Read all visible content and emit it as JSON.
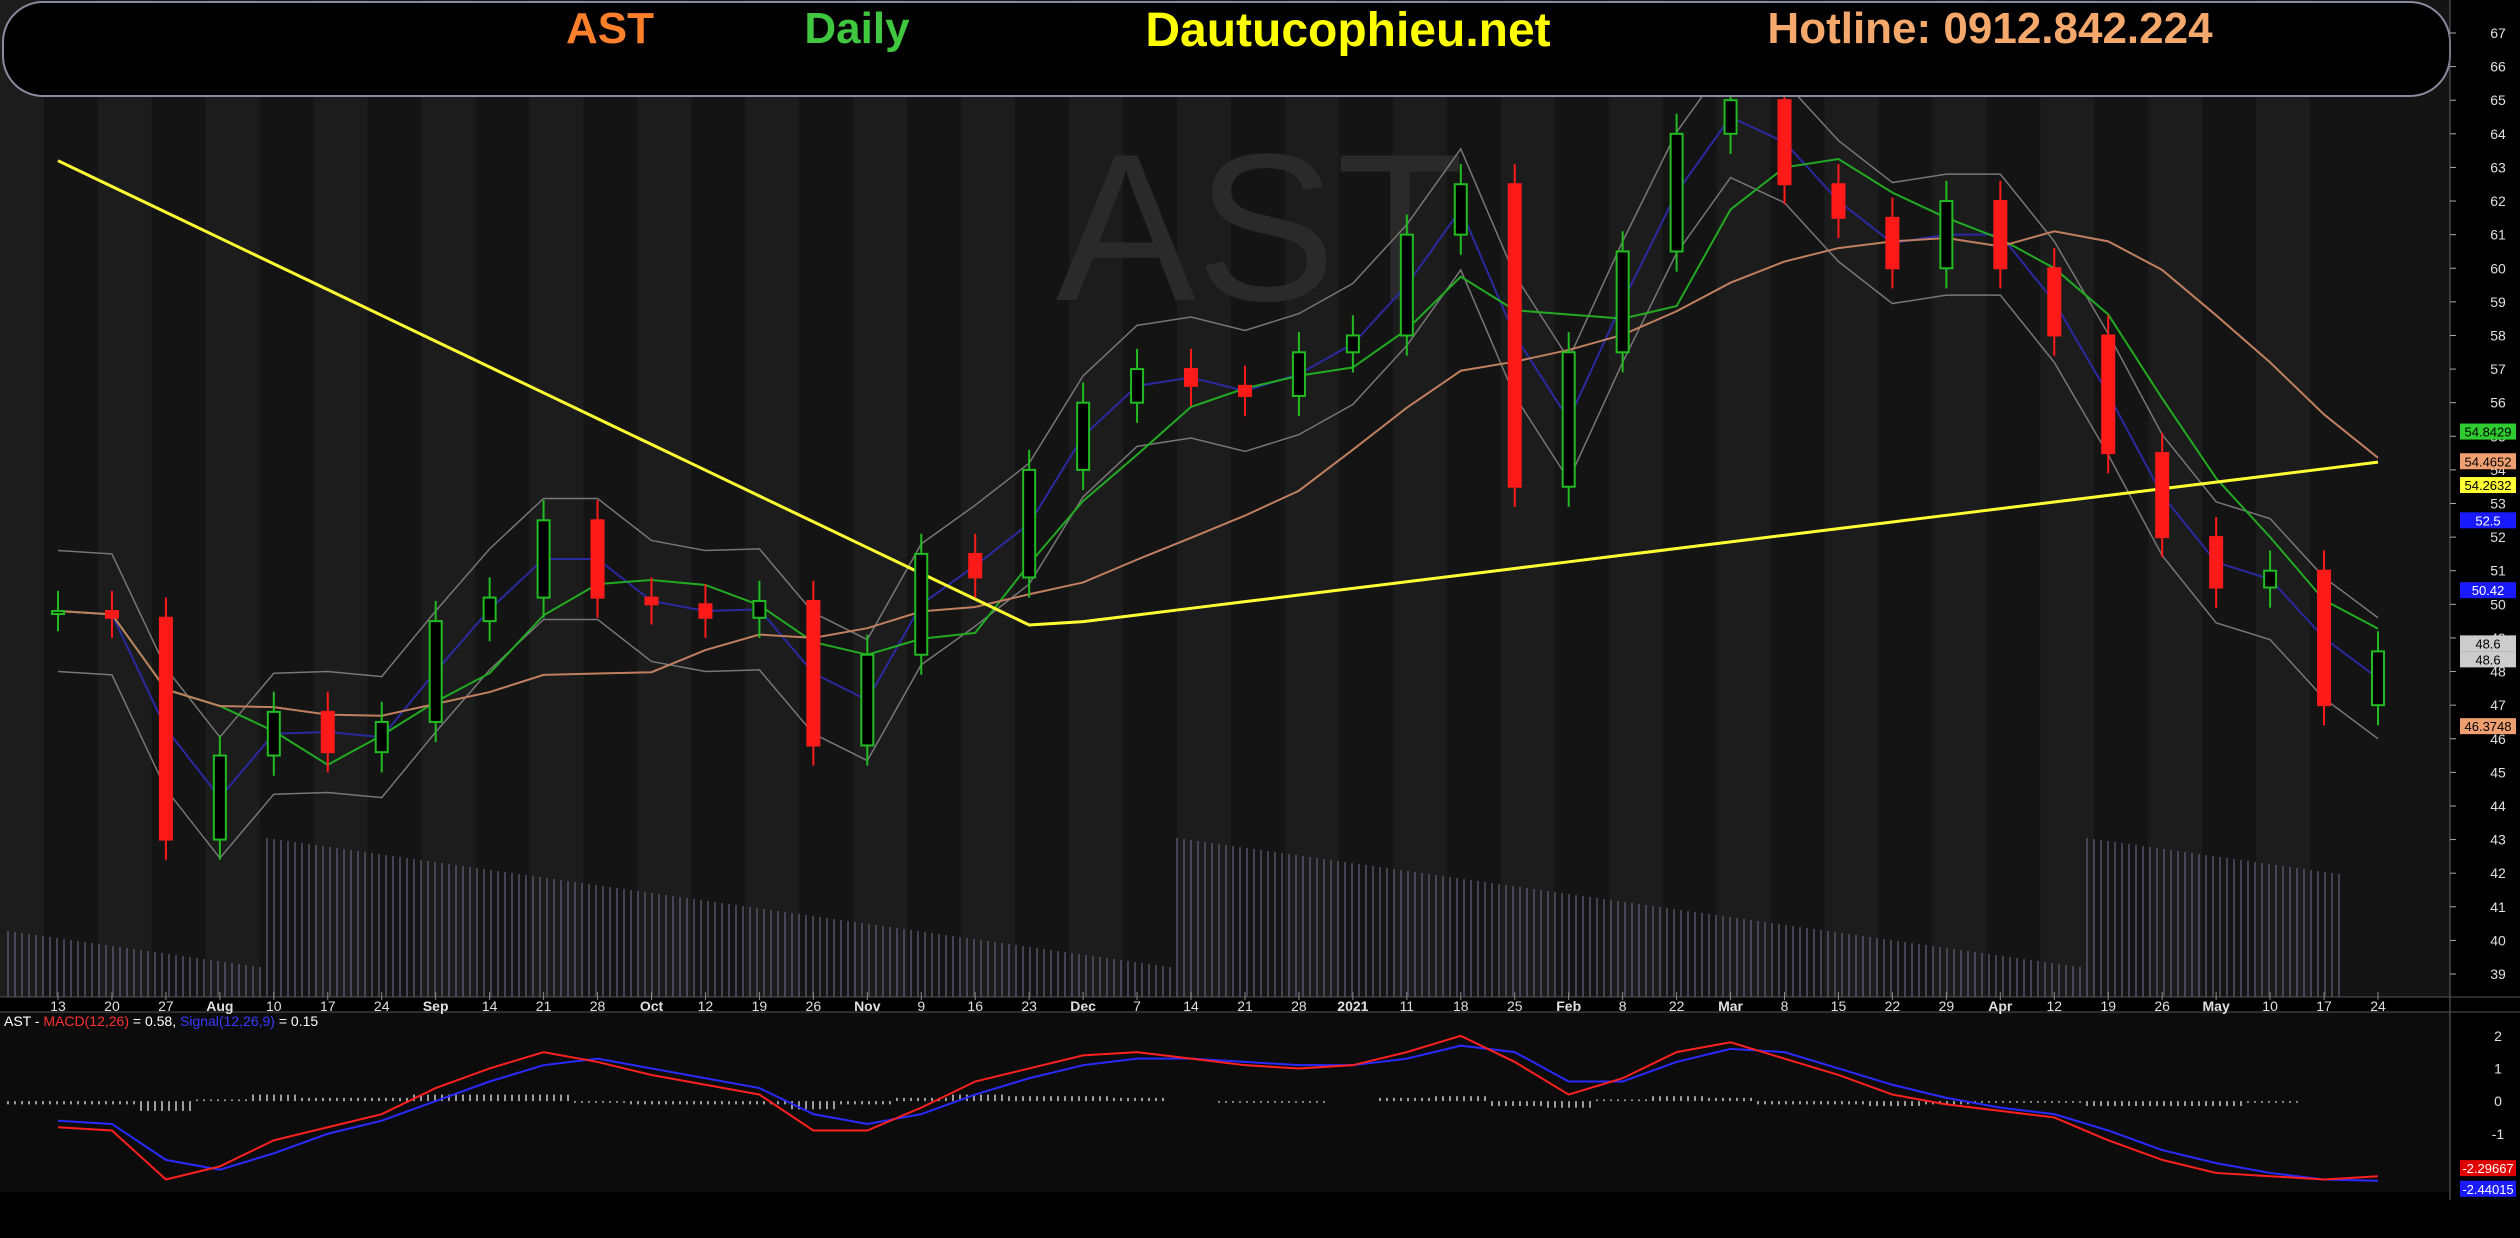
{
  "banner": {
    "symbol": "AST",
    "interval": "Daily",
    "site": "Dautucophieu.net",
    "hotline": "Hotline: 0912.842.224",
    "colors": {
      "symbol": "#ff7f2a",
      "interval": "#3fc73f",
      "site": "#ffff00",
      "hotline": "#f5a86b"
    }
  },
  "watermark": "AST",
  "price_axis": {
    "ticks": [
      39,
      40,
      41,
      42,
      43,
      44,
      45,
      46,
      47,
      48,
      49,
      50,
      51,
      52,
      53,
      54,
      55,
      56,
      57,
      58,
      59,
      60,
      61,
      62,
      63,
      64,
      65,
      66,
      67
    ]
  },
  "x_axis": {
    "labels": [
      "13",
      "20",
      "27",
      "Aug",
      "10",
      "17",
      "24",
      "Sep",
      "14",
      "21",
      "28",
      "Oct",
      "12",
      "19",
      "26",
      "Nov",
      "9",
      "16",
      "23",
      "Dec",
      "7",
      "14",
      "21",
      "28",
      "2021",
      "11",
      "18",
      "25",
      "Feb",
      "8",
      "22",
      "Mar",
      "8",
      "15",
      "22",
      "29",
      "Apr",
      "12",
      "19",
      "26",
      "May",
      "10",
      "17",
      "24"
    ]
  },
  "badges": [
    {
      "text": "54.8429",
      "bg": "#2ecc2e",
      "fg": "#000000"
    },
    {
      "text": "54.4652",
      "bg": "#f0a070",
      "fg": "#000000"
    },
    {
      "text": "54.2632",
      "bg": "#ffff33",
      "fg": "#000000"
    },
    {
      "text": "52.5",
      "bg": "#1a1aff",
      "fg": "#ffffff"
    },
    {
      "text": "50.42",
      "bg": "#1a1aff",
      "fg": "#ffffff"
    },
    {
      "text": "48.6",
      "bg": "#cccccc",
      "fg": "#000000"
    },
    {
      "text": "48.6",
      "bg": "#cccccc",
      "fg": "#000000"
    },
    {
      "text": "46.3748",
      "bg": "#f0a070",
      "fg": "#000000"
    }
  ],
  "macd_panel": {
    "legend": {
      "prefix": "AST - ",
      "macd": "MACD(12,26)",
      "macd_val": " = 0.58, ",
      "signal": "Signal(12,26,9)",
      "signal_val": " = 0.15"
    },
    "ticks": [
      "2",
      "1",
      "0",
      "-1",
      "-2"
    ],
    "badges": [
      {
        "text": "-2.29667",
        "bg": "#e00000",
        "fg": "#ffffff"
      },
      {
        "text": "-2.44015",
        "bg": "#1a1aff",
        "fg": "#ffffff"
      }
    ]
  },
  "chart_data": {
    "type": "candlestick",
    "ylim": [
      38.5,
      67.5
    ],
    "x": [
      "13",
      "20",
      "27",
      "Aug",
      "10",
      "17",
      "24",
      "Sep",
      "14",
      "21",
      "28",
      "Oct",
      "12",
      "19",
      "26",
      "Nov",
      "9",
      "16",
      "23",
      "Dec",
      "7",
      "14",
      "21",
      "28",
      "2021",
      "11",
      "18",
      "25",
      "Feb",
      "8",
      "22",
      "Mar",
      "8",
      "15",
      "22",
      "29",
      "Apr",
      "12",
      "19",
      "26",
      "May",
      "10",
      "17",
      "24"
    ],
    "close": [
      49.8,
      49.6,
      43.0,
      45.5,
      46.8,
      45.6,
      46.5,
      49.5,
      50.2,
      52.5,
      50.2,
      50.0,
      49.6,
      50.1,
      45.8,
      48.5,
      51.5,
      50.8,
      54.0,
      56.0,
      57.0,
      56.5,
      56.2,
      57.5,
      58.0,
      61.0,
      62.5,
      53.5,
      57.5,
      60.5,
      64.0,
      65.0,
      62.5,
      61.5,
      60.0,
      62.0,
      60.0,
      58.0,
      54.5,
      52.0,
      50.5,
      51.0,
      47.0,
      48.6
    ],
    "ma_levels": {
      "ma_green": 54.8429,
      "ma_orange": 54.4652,
      "ma_yellow": 54.2632,
      "bb_upper": 52.5,
      "ma_blue": 50.42,
      "last_close": 48.6,
      "bb_lower": 46.3748
    },
    "macd": {
      "ylim": [
        -2.6,
        2.3
      ],
      "macd_last": -2.29667,
      "signal_last": -2.44015,
      "legend_macd": 0.58,
      "legend_signal": 0.15
    },
    "series": [
      {
        "name": "MACD(12,26)",
        "values": [
          -0.8,
          -0.9,
          -2.4,
          -2.0,
          -1.2,
          -0.8,
          -0.4,
          0.4,
          1.0,
          1.5,
          1.2,
          0.8,
          0.5,
          0.2,
          -0.9,
          -0.9,
          -0.2,
          0.6,
          1.0,
          1.4,
          1.5,
          1.3,
          1.1,
          1.0,
          1.1,
          1.5,
          2.0,
          1.2,
          0.2,
          0.7,
          1.5,
          1.8,
          1.3,
          0.8,
          0.2,
          -0.1,
          -0.3,
          -0.5,
          -1.2,
          -1.8,
          -2.2,
          -2.3,
          -2.4,
          -2.3
        ]
      },
      {
        "name": "Signal(12,26,9)",
        "values": [
          -0.6,
          -0.7,
          -1.8,
          -2.1,
          -1.6,
          -1.0,
          -0.6,
          0.0,
          0.6,
          1.1,
          1.3,
          1.0,
          0.7,
          0.4,
          -0.4,
          -0.7,
          -0.4,
          0.2,
          0.7,
          1.1,
          1.3,
          1.3,
          1.2,
          1.1,
          1.1,
          1.3,
          1.7,
          1.5,
          0.6,
          0.6,
          1.2,
          1.6,
          1.5,
          1.0,
          0.5,
          0.1,
          -0.2,
          -0.4,
          -0.9,
          -1.5,
          -1.9,
          -2.2,
          -2.4,
          -2.44
        ]
      }
    ]
  }
}
